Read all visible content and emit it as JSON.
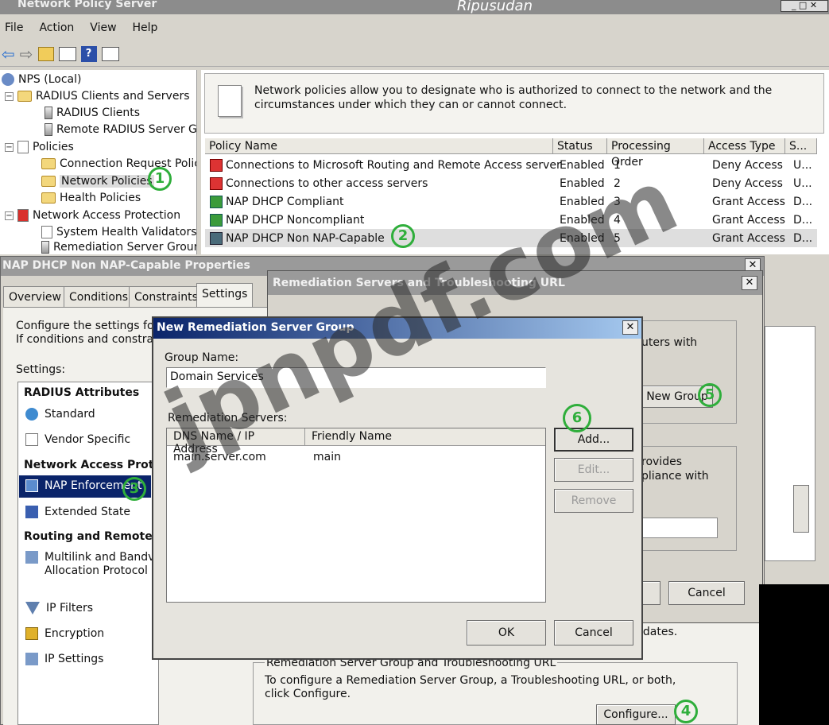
{
  "window": {
    "title": "Network Policy Server",
    "overlay_title": "Ripusudan"
  },
  "menu": [
    "File",
    "Action",
    "View",
    "Help"
  ],
  "tree": {
    "root": "NPS (Local)",
    "radius": "RADIUS Clients and Servers",
    "radius_clients": "RADIUS Clients",
    "remote_groups": "Remote RADIUS Server G",
    "policies": "Policies",
    "conn_req": "Connection Request Polici",
    "network_policies": "Network Policies",
    "health_policies": "Health Policies",
    "nap": "Network Access Protection",
    "shv": "System Health Validators",
    "remediation": "Remediation Server Grour"
  },
  "info": {
    "text": "Network policies allow you to designate who is authorized to connect to the network and the circumstances under which they can or cannot connect."
  },
  "policy_table": {
    "headers": [
      "Policy Name",
      "Status",
      "Processing Order",
      "Access Type",
      "S..."
    ],
    "rows": [
      {
        "name": "Connections to Microsoft Routing and Remote Access server",
        "status": "Enabled",
        "order": "1",
        "access": "Deny Access",
        "s": "U..."
      },
      {
        "name": "Connections to other access servers",
        "status": "Enabled",
        "order": "2",
        "access": "Deny Access",
        "s": "U..."
      },
      {
        "name": "NAP DHCP Compliant",
        "status": "Enabled",
        "order": "3",
        "access": "Grant Access",
        "s": "D..."
      },
      {
        "name": "NAP DHCP Noncompliant",
        "status": "Enabled",
        "order": "4",
        "access": "Grant Access",
        "s": "D..."
      },
      {
        "name": "NAP DHCP Non NAP-Capable",
        "status": "Enabled",
        "order": "5",
        "access": "Grant Access",
        "s": "D..."
      }
    ]
  },
  "properties": {
    "title": "NAP DHCP Non NAP-Capable Properties",
    "tabs": [
      "Overview",
      "Conditions",
      "Constraints",
      "Settings"
    ],
    "desc1": "Configure the settings for th",
    "desc2": "If conditions and constraint",
    "settings_label": "Settings:",
    "group_radius": "RADIUS Attributes",
    "standard": "Standard",
    "vendor": "Vendor Specific",
    "group_nap": "Network Access Prote",
    "nap_enf": "NAP Enforcement",
    "ext_state": "Extended State",
    "group_routing": "Routing and Remote A",
    "multilink": "Multilink and Bandv",
    "multilink2": "Allocation Protocol",
    "ip_filters": "IP Filters",
    "encryption": "Encryption",
    "ip_settings": "IP Settings",
    "updates_text": "pdates.",
    "remed_group_label": "Remediation Server Group and Troubleshooting URL",
    "remed_desc": "To configure a Remediation Server Group, a Troubleshooting URL, or both, click Configure.",
    "configure_btn": "Configure..."
  },
  "remediation_dialog": {
    "title": "Remediation Servers and Troubleshooting URL",
    "text1": "uters with",
    "new_group_btn": "New Group",
    "text2": "rovides",
    "text3": "pliance with",
    "cancel_btn": "Cancel"
  },
  "new_group_dialog": {
    "title": "New Remediation Server Group",
    "group_name_label": "Group Name:",
    "group_name_value": "Domain Services",
    "servers_label": "Remediation Servers:",
    "col_dns": "DNS Name / IP Address",
    "col_friendly": "Friendly Name",
    "server_dns": "main.server.com",
    "server_friendly": "main",
    "add_btn": "Add...",
    "edit_btn": "Edit...",
    "remove_btn": "Remove",
    "ok_btn": "OK",
    "cancel_btn": "Cancel"
  },
  "step_markers": [
    "1",
    "2",
    "3",
    "4",
    "5",
    "6"
  ],
  "watermark": "jpnpdf.com",
  "colors": {
    "accent": "#0a246a",
    "marker": "#2fae3b",
    "selection": "#0a246a"
  }
}
